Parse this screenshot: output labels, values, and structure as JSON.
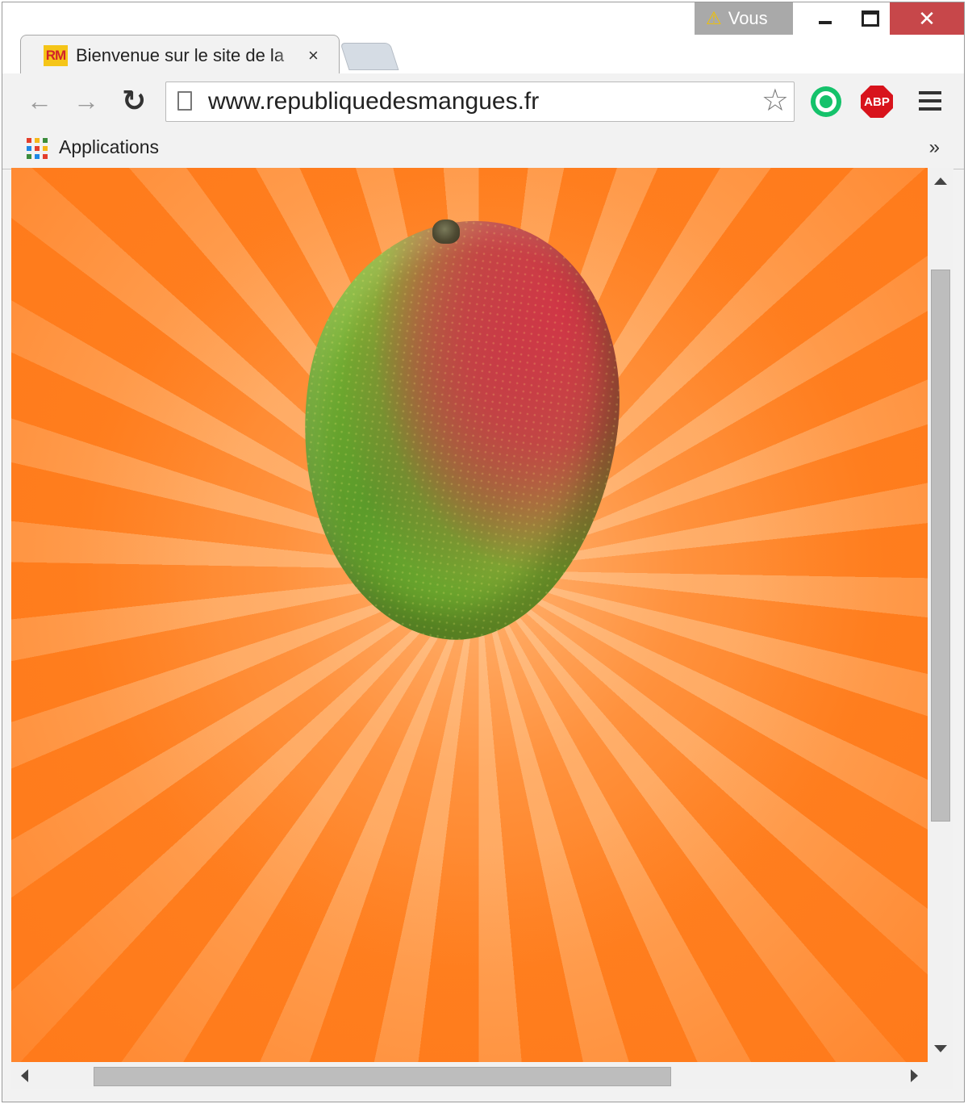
{
  "window": {
    "profile_label": "Vous",
    "warning_icon": "warning-icon",
    "close_glyph": "✕"
  },
  "tab": {
    "favicon_text": "RM",
    "title": "Bienvenue sur le site de la",
    "close_glyph": "×"
  },
  "toolbar": {
    "back_glyph": "←",
    "forward_glyph": "→",
    "reload_glyph": "↻",
    "url": "www.republiquedesmangues.fr",
    "star_glyph": "☆",
    "abp_label": "ABP"
  },
  "bookmarks": {
    "apps_label": "Applications",
    "overflow_glyph": "»"
  },
  "colors": {
    "background_orange": "#ff7f1f",
    "ray_light": "#ffa55a",
    "favicon_bg": "#f5c518",
    "favicon_text": "#d2232a",
    "close_button": "#c7474a",
    "ext_green": "#15c26b",
    "abp_red": "#d8131c"
  },
  "apps_grid_colors": [
    "#e43e2b",
    "#f6b81a",
    "#3c8c3c",
    "#1f88e5",
    "#e43e2b",
    "#f6b81a",
    "#3c8c3c",
    "#1f88e5",
    "#e43e2b"
  ],
  "page": {
    "content": "mango-image"
  }
}
